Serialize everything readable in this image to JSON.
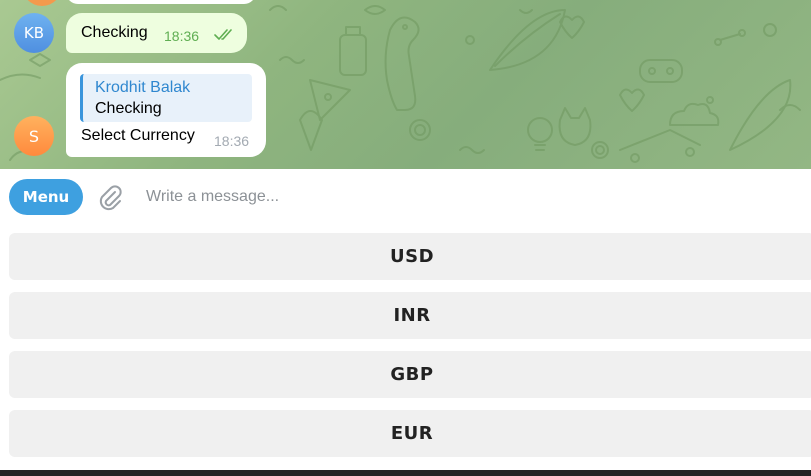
{
  "colors": {
    "chat_background": "#8fb57f",
    "outgoing_bubble": "#eefedf",
    "incoming_bubble": "#ffffff",
    "accent": "#3ea0e0",
    "reply_name": "#2f87cf",
    "keyboard_button": "#f0f0f0"
  },
  "messages": {
    "outgoing": {
      "avatar_initials": "KB",
      "text": "Checking",
      "time": "18:36",
      "status_icon": "double-check-icon"
    },
    "incoming": {
      "avatar_initials": "S",
      "reply_to_name": "Krodhit Balak",
      "reply_to_text": "Checking",
      "text": "Select Currency",
      "time": "18:36"
    }
  },
  "composer": {
    "menu_label": "Menu",
    "attach_icon": "paperclip-icon",
    "placeholder": "Write a message..."
  },
  "keyboard": {
    "buttons": [
      "USD",
      "INR",
      "GBP",
      "EUR"
    ]
  }
}
